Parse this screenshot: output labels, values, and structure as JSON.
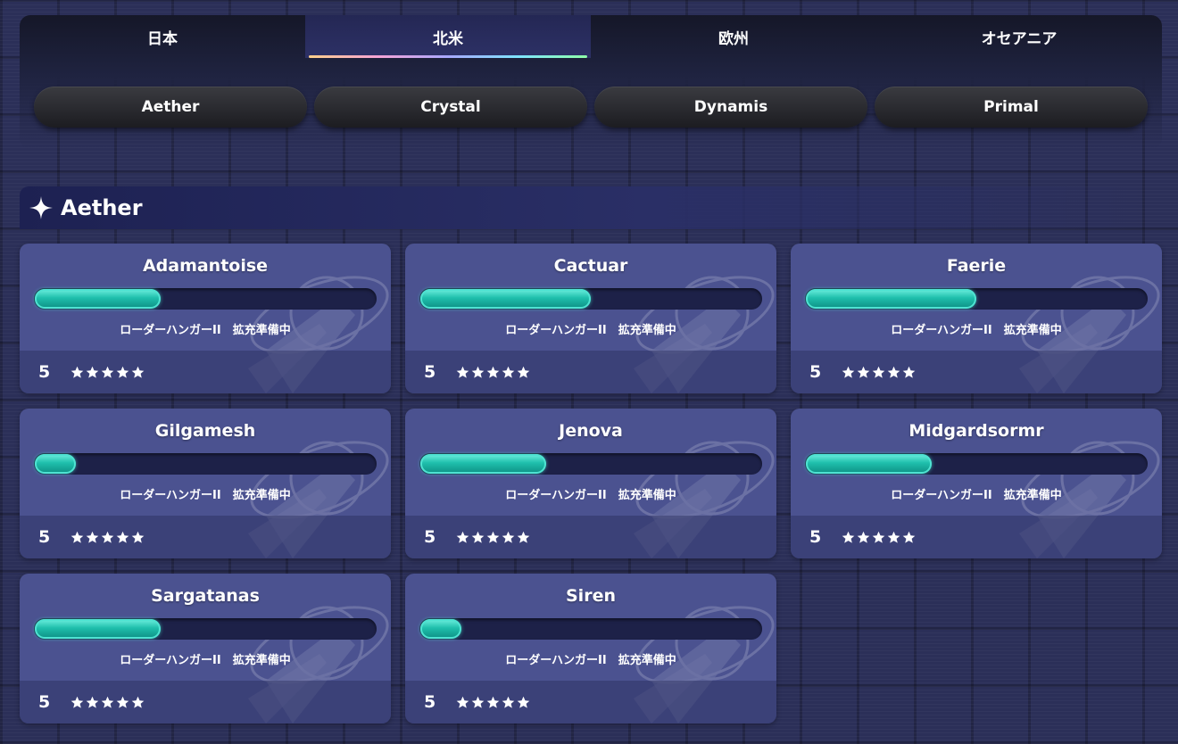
{
  "region_tabs": [
    {
      "label": "日本",
      "active": false
    },
    {
      "label": "北米",
      "active": true
    },
    {
      "label": "欧州",
      "active": false
    },
    {
      "label": "オセアニア",
      "active": false
    }
  ],
  "datacenters": [
    "Aether",
    "Crystal",
    "Dynamis",
    "Primal"
  ],
  "section": {
    "title": "Aether",
    "icon": "sparkle-icon"
  },
  "worlds": [
    {
      "name": "Adamantoise",
      "progress": 0.37,
      "status": "ローダーハンガーII　拡充準備中",
      "level": "5",
      "stars": 5
    },
    {
      "name": "Cactuar",
      "progress": 0.5,
      "status": "ローダーハンガーII　拡充準備中",
      "level": "5",
      "stars": 5
    },
    {
      "name": "Faerie",
      "progress": 0.5,
      "status": "ローダーハンガーII　拡充準備中",
      "level": "5",
      "stars": 5
    },
    {
      "name": "Gilgamesh",
      "progress": 0.12,
      "status": "ローダーハンガーII　拡充準備中",
      "level": "5",
      "stars": 5
    },
    {
      "name": "Jenova",
      "progress": 0.37,
      "status": "ローダーハンガーII　拡充準備中",
      "level": "5",
      "stars": 5
    },
    {
      "name": "Midgardsormr",
      "progress": 0.37,
      "status": "ローダーハンガーII　拡充準備中",
      "level": "5",
      "stars": 5
    },
    {
      "name": "Sargatanas",
      "progress": 0.37,
      "status": "ローダーハンガーII　拡充準備中",
      "level": "5",
      "stars": 5
    },
    {
      "name": "Siren",
      "progress": 0.12,
      "status": "ローダーハンガーII　拡充準備中",
      "level": "5",
      "stars": 5
    }
  ],
  "colors": {
    "accent": "#2fd3c0",
    "card": "#4b5290",
    "background": "#2b2f58"
  }
}
